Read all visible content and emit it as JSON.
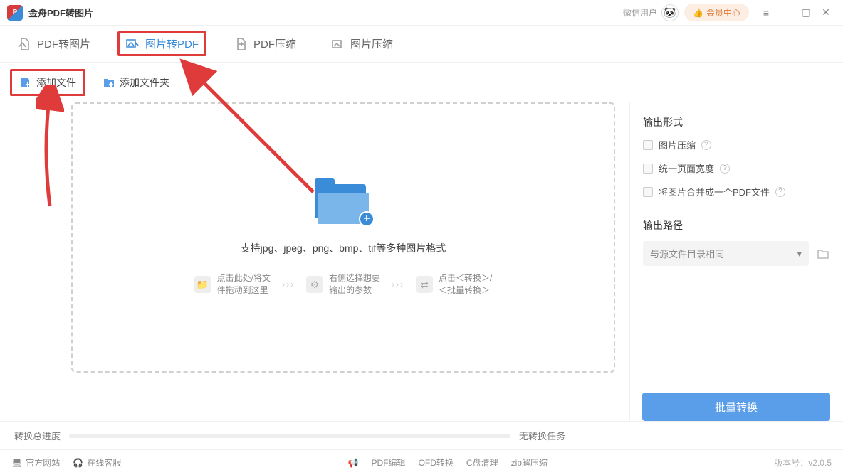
{
  "titlebar": {
    "app_title": "金舟PDF转图片",
    "wx_user": "微信用户",
    "member_btn": "会员中心"
  },
  "tabs": [
    {
      "label": "PDF转图片"
    },
    {
      "label": "图片转PDF"
    },
    {
      "label": "PDF压缩"
    },
    {
      "label": "图片压缩"
    }
  ],
  "toolbar": {
    "add_file": "添加文件",
    "add_folder": "添加文件夹"
  },
  "dropzone": {
    "support_text": "支持jpg、jpeg、png、bmp、tif等多种图片格式",
    "steps": [
      {
        "line1": "点击此处/将文",
        "line2": "件拖动到这里"
      },
      {
        "line1": "右侧选择想要",
        "line2": "输出的参数"
      },
      {
        "line1": "点击＜转换＞/",
        "line2": "＜批量转换＞"
      }
    ]
  },
  "right_panel": {
    "output_format_title": "输出形式",
    "opt_compress": "图片压缩",
    "opt_uniwidth": "统一页面宽度",
    "opt_merge": "将图片合并成一个PDF文件",
    "output_path_title": "输出路径",
    "output_path_value": "与源文件目录相同"
  },
  "progress": {
    "label": "转换总进度",
    "status": "无转换任务"
  },
  "convert_btn": "批量转换",
  "statusbar": {
    "official_site": "官方网站",
    "online_support": "在线客服",
    "tools": [
      "PDF编辑",
      "OFD转换",
      "C盘清理",
      "zip解压缩"
    ],
    "version": "版本号：v2.0.5"
  }
}
